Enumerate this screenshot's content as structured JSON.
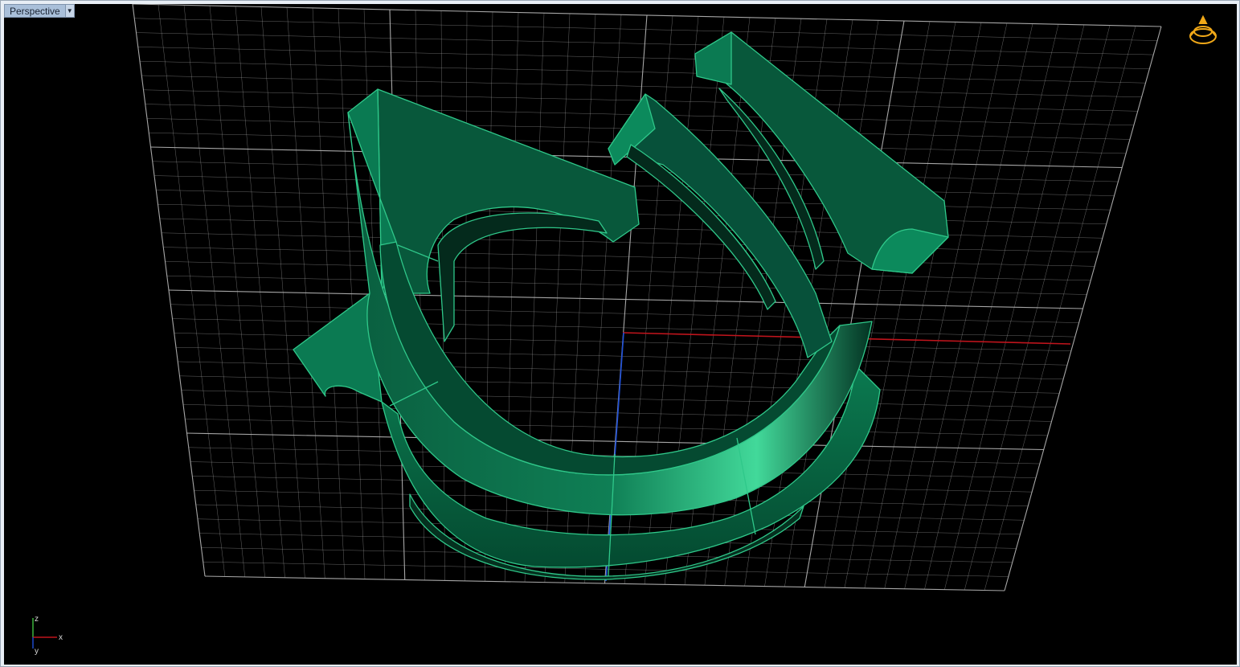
{
  "viewport": {
    "title": "Perspective",
    "dropdown_icon": "chevron-down-icon",
    "background": "#000000"
  },
  "scene": {
    "object_color": "#0d7a52",
    "edge_color": "#2fc88a",
    "grid_color": "#b8b8b8",
    "x_axis_color": "#c0141c",
    "y_axis_color": "#1e4fd8"
  },
  "axis_widget": {
    "x_label": "x",
    "y_label": "y",
    "z_label": "z"
  },
  "nav_widget": {
    "icon": "ring-orbit-icon",
    "color": "#f0a818"
  }
}
